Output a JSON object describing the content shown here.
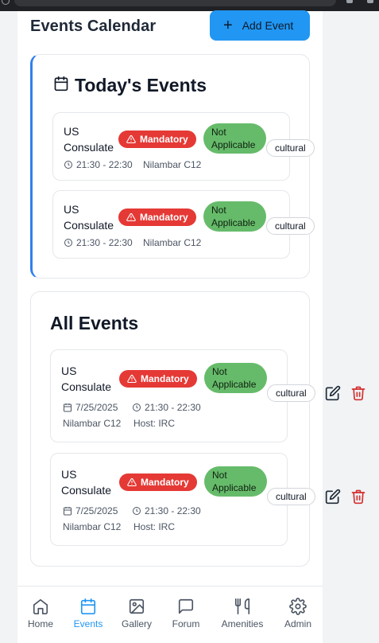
{
  "header": {
    "title": "Events Calendar",
    "add_button_label": "Add Event"
  },
  "today": {
    "title": "Today's Events",
    "events": [
      {
        "title": "US Consulate",
        "badge_mandatory": "Mandatory",
        "badge_status": "Not Applicable",
        "tag": "cultural",
        "time": "21:30 - 22:30",
        "location": "Nilambar C12"
      },
      {
        "title": "US Consulate",
        "badge_mandatory": "Mandatory",
        "badge_status": "Not Applicable",
        "tag": "cultural",
        "time": "21:30 - 22:30",
        "location": "Nilambar C12"
      }
    ]
  },
  "all": {
    "title": "All Events",
    "events": [
      {
        "title": "US Consulate",
        "badge_mandatory": "Mandatory",
        "badge_status": "Not Applicable",
        "tag": "cultural",
        "date": "7/25/2025",
        "time": "21:30 - 22:30",
        "location": "Nilambar C12",
        "host": "Host: IRC"
      },
      {
        "title": "US Consulate",
        "badge_mandatory": "Mandatory",
        "badge_status": "Not Applicable",
        "tag": "cultural",
        "date": "7/25/2025",
        "time": "21:30 - 22:30",
        "location": "Nilambar C12",
        "host": "Host: IRC"
      }
    ]
  },
  "nav": {
    "items": [
      {
        "label": "Home",
        "icon": "home-icon"
      },
      {
        "label": "Events",
        "icon": "calendar-icon",
        "active": true
      },
      {
        "label": "Gallery",
        "icon": "image-icon"
      },
      {
        "label": "Forum",
        "icon": "chat-icon"
      },
      {
        "label": "Amenities",
        "icon": "utensils-icon"
      },
      {
        "label": "Admin",
        "icon": "gear-icon"
      }
    ]
  },
  "colors": {
    "accent": "#2196f3",
    "mandatory": "#e53935",
    "status": "#66bb6a",
    "delete": "#d32f2f"
  }
}
